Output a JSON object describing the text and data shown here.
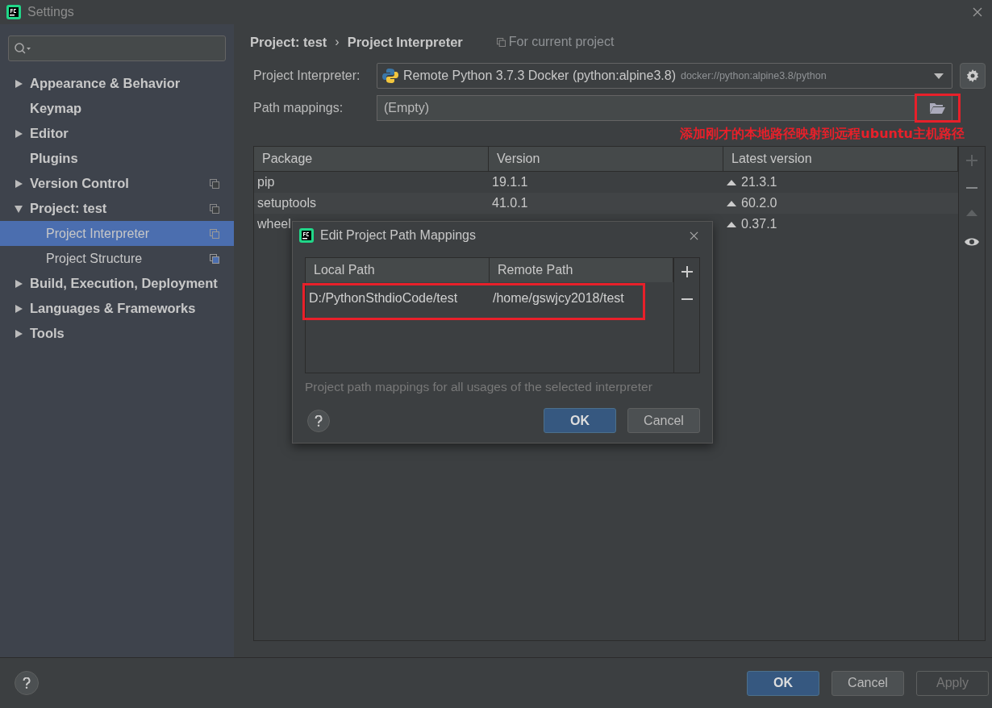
{
  "window": {
    "title": "Settings"
  },
  "sidebar": {
    "items": [
      {
        "label": "Appearance & Behavior",
        "kind": "folder",
        "expanded": false,
        "selected": false,
        "project_scoped": false
      },
      {
        "label": "Keymap",
        "kind": "page",
        "selected": false,
        "project_scoped": false
      },
      {
        "label": "Editor",
        "kind": "folder",
        "expanded": false,
        "selected": false,
        "project_scoped": false
      },
      {
        "label": "Plugins",
        "kind": "page",
        "selected": false,
        "project_scoped": false
      },
      {
        "label": "Version Control",
        "kind": "folder",
        "expanded": false,
        "selected": false,
        "project_scoped": true
      },
      {
        "label": "Project: test",
        "kind": "folder",
        "expanded": true,
        "selected": false,
        "project_scoped": true,
        "children": [
          {
            "label": "Project Interpreter",
            "selected": true,
            "project_scoped": true
          },
          {
            "label": "Project Structure",
            "selected": false,
            "project_scoped": true
          }
        ]
      },
      {
        "label": "Build, Execution, Deployment",
        "kind": "folder",
        "expanded": false,
        "selected": false,
        "project_scoped": false
      },
      {
        "label": "Languages & Frameworks",
        "kind": "folder",
        "expanded": false,
        "selected": false,
        "project_scoped": false
      },
      {
        "label": "Tools",
        "kind": "folder",
        "expanded": false,
        "selected": false,
        "project_scoped": false
      }
    ]
  },
  "breadcrumb": {
    "parent": "Project: test",
    "separator": "›",
    "current": "Project Interpreter",
    "scope": "For current project"
  },
  "interpreter": {
    "label": "Project Interpreter:",
    "value": "Remote Python 3.7.3 Docker (python:alpine3.8)",
    "path": "docker://python:alpine3.8/python"
  },
  "path_mappings": {
    "label": "Path mappings:",
    "value": "(Empty)"
  },
  "annotation": {
    "text": "添加刚才的本地路径映射到远程ubuntu主机路径"
  },
  "packages": {
    "columns": [
      "Package",
      "Version",
      "Latest version"
    ],
    "rows": [
      {
        "package": "pip",
        "version": "19.1.1",
        "latest": "21.3.1"
      },
      {
        "package": "setuptools",
        "version": "41.0.1",
        "latest": "60.2.0"
      },
      {
        "package": "wheel",
        "latest": "0.37.1"
      }
    ]
  },
  "dialog": {
    "title": "Edit Project Path Mappings",
    "columns": [
      "Local Path",
      "Remote Path"
    ],
    "rows": [
      {
        "local": "D:/PythonSthdioCode/test",
        "remote": "/home/gswjcy2018/test"
      }
    ],
    "note": "Project path mappings for all usages of the selected interpreter",
    "buttons": [
      {
        "label": "OK",
        "primary": true
      },
      {
        "label": "Cancel",
        "primary": false
      }
    ]
  },
  "footer": {
    "buttons": [
      {
        "label": "OK",
        "primary": true,
        "disabled": false
      },
      {
        "label": "Cancel",
        "primary": false,
        "disabled": false
      },
      {
        "label": "Apply",
        "primary": false,
        "disabled": true
      }
    ]
  }
}
